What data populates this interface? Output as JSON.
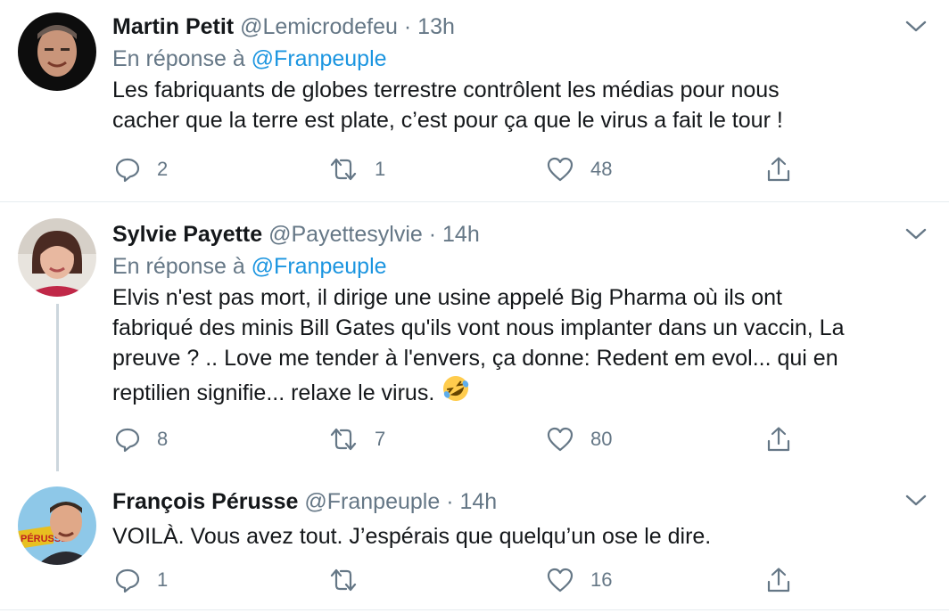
{
  "tweets": [
    {
      "name": "Martin Petit",
      "handle": "@Lemicrodefeu",
      "dot": "·",
      "time": "13h",
      "reply_prefix": "En réponse à",
      "reply_to": "@Franpeuple",
      "text_lines": [
        "Les fabriquants de globes terrestre contrôlent les médias pour nous",
        "cacher que la terre est plate, c’est pour ça que le virus a fait le tour !"
      ],
      "replies": "2",
      "retweets": "1",
      "likes": "48"
    },
    {
      "name": "Sylvie Payette",
      "handle": "@Payettesylvie",
      "dot": "·",
      "time": "14h",
      "reply_prefix": "En réponse à",
      "reply_to": "@Franpeuple",
      "text_lines": [
        "Elvis n'est pas mort, il dirige une usine appelé Big Pharma où ils ont",
        "fabriqué des minis Bill Gates qu'ils vont nous implanter dans un vaccin, La",
        "preuve ? .. Love me tender à l'envers, ça donne:  Redent em evol... qui en",
        "reptilien signifie... relaxe le virus."
      ],
      "emoji": "rolling-on-floor-laughing-emoji",
      "replies": "8",
      "retweets": "7",
      "likes": "80"
    },
    {
      "name": "François Pérusse",
      "handle": "@Franpeuple",
      "dot": "·",
      "time": "14h",
      "text_lines": [
        "VOILÀ. Vous avez tout. J’espérais que quelqu’un ose le dire."
      ],
      "avatar_sign": "PÉRUSSE",
      "replies": "1",
      "retweets": "",
      "likes": "16"
    }
  ],
  "colors": {
    "text": "#14171a",
    "secondary": "#657786",
    "link": "#1b95e0",
    "border": "#e6ecf0",
    "thread": "#ccd6dd"
  }
}
